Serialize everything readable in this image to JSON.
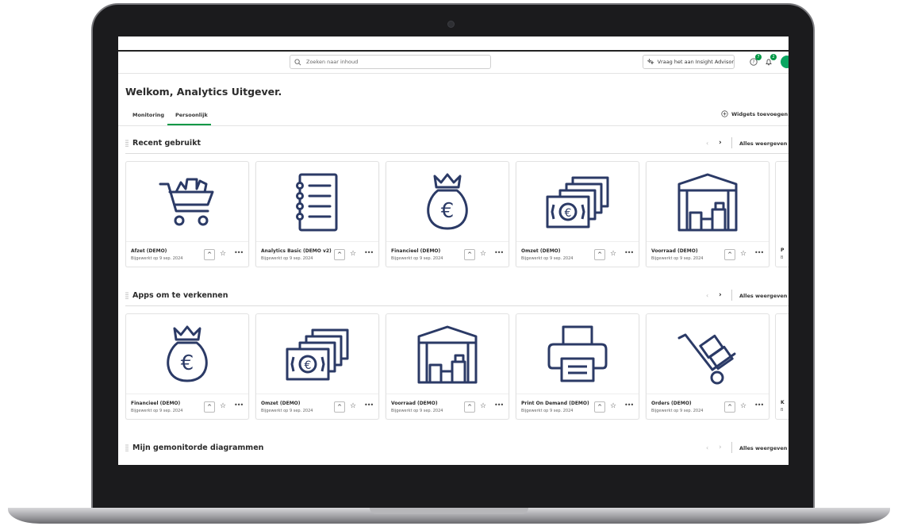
{
  "topbar": {
    "search_placeholder": "Zoeken naar inhoud",
    "insight_label": "Vraag het aan Insight Advisor",
    "help_badge": "7",
    "bell_badge": "2"
  },
  "header": {
    "welcome": "Welkom, Analytics Uitgever.",
    "tabs": [
      {
        "label": "Monitoring"
      },
      {
        "label": "Persoonlijk",
        "active": true
      }
    ],
    "widgets_label": "Widgets toevoegen"
  },
  "sections": [
    {
      "title": "Recent gebruikt",
      "all_label": "Alles weergeven",
      "cards": [
        {
          "name": "Afzet (DEMO)",
          "date": "Bijgewerkt op 9 sep. 2024",
          "icon": "shopping-cart-icon"
        },
        {
          "name": "Analytics Basic (DEMO v2)",
          "date": "Bijgewerkt op 9 sep. 2024",
          "icon": "notebook-list-icon"
        },
        {
          "name": "Financieel (DEMO)",
          "date": "Bijgewerkt op 9 sep. 2024",
          "icon": "money-bag-euro-icon"
        },
        {
          "name": "Omzet (DEMO)",
          "date": "Bijgewerkt op 9 sep. 2024",
          "icon": "banknotes-euro-icon"
        },
        {
          "name": "Voorraad (DEMO)",
          "date": "Bijgewerkt op 9 sep. 2024",
          "icon": "warehouse-icon"
        }
      ],
      "partial_letter": "P",
      "partial_letter2": "B"
    },
    {
      "title": "Apps om te verkennen",
      "all_label": "Alles weergeven",
      "cards": [
        {
          "name": "Financieel (DEMO)",
          "date": "Bijgewerkt op 9 sep. 2024",
          "icon": "money-bag-euro-icon"
        },
        {
          "name": "Omzet (DEMO)",
          "date": "Bijgewerkt op 9 sep. 2024",
          "icon": "banknotes-euro-icon"
        },
        {
          "name": "Voorraad (DEMO)",
          "date": "Bijgewerkt op 9 sep. 2024",
          "icon": "warehouse-icon"
        },
        {
          "name": "Print On Demand (DEMO)",
          "date": "Bijgewerkt op 9 sep. 2024",
          "icon": "printer-icon"
        },
        {
          "name": "Orders (DEMO)",
          "date": "Bijgewerkt op 9 sep. 2024",
          "icon": "hand-truck-icon"
        }
      ],
      "partial_letter": "K",
      "partial_letter2": "B"
    },
    {
      "title": "Mijn gemonitorde diagrammen",
      "all_label": "Alles weergeven"
    }
  ],
  "colors": {
    "accent": "#009845",
    "icon_stroke": "#2b3a66"
  }
}
